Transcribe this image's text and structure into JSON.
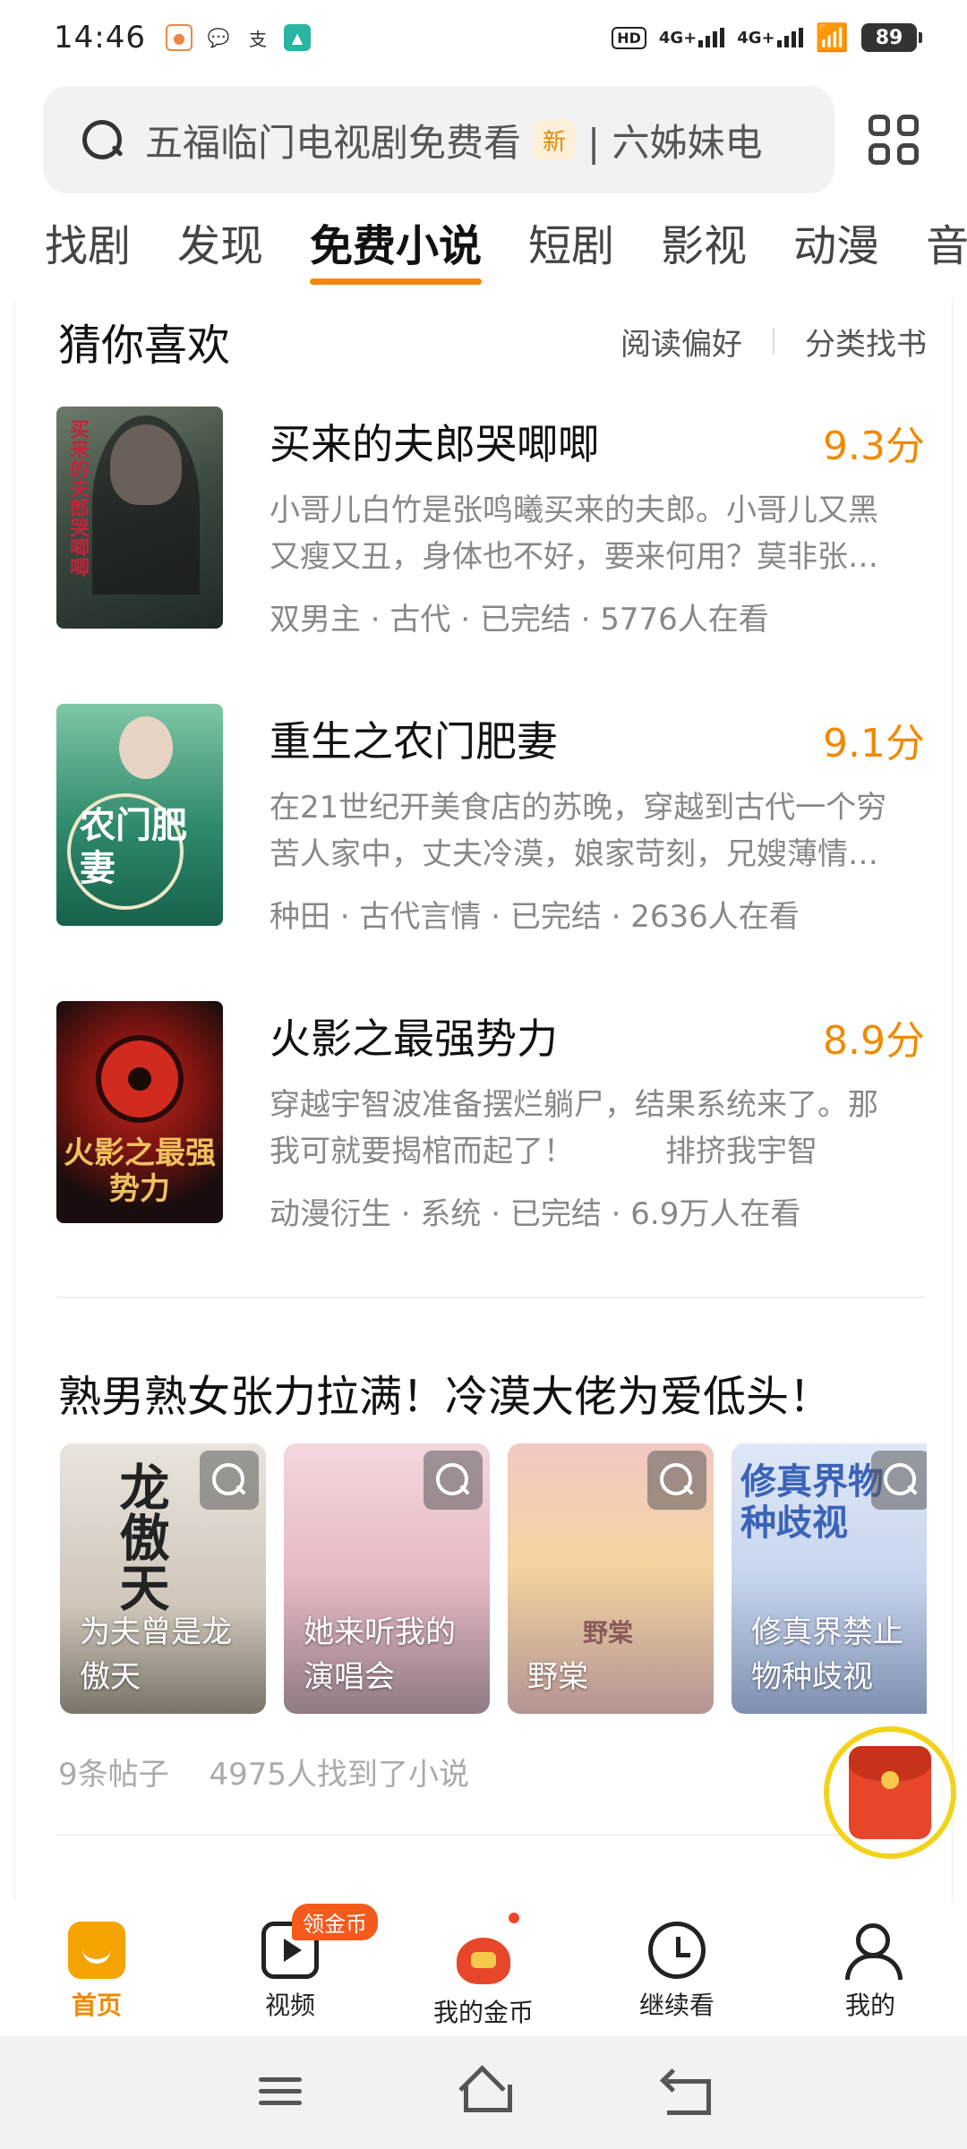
{
  "status_bar": {
    "time": "14:46",
    "app_icons": [
      "notification-app-icon",
      "message-icon",
      "alipay-icon",
      "app-store-icon"
    ],
    "hd_label": "HD",
    "net1": "4G+",
    "net2": "4G+",
    "battery": "89"
  },
  "search": {
    "placeholder_main": "五福临门电视剧免费看",
    "badge": "新",
    "placeholder_next": "| 六姊妹电"
  },
  "tabs": [
    {
      "label": "找剧",
      "active": false
    },
    {
      "label": "发现",
      "active": false
    },
    {
      "label": "免费小说",
      "active": true
    },
    {
      "label": "短剧",
      "active": false
    },
    {
      "label": "影视",
      "active": false
    },
    {
      "label": "动漫",
      "active": false
    },
    {
      "label": "音乐",
      "active": false
    }
  ],
  "recommend": {
    "title": "猜你喜欢",
    "link_prefs": "阅读偏好",
    "link_category": "分类找书",
    "books": [
      {
        "title": "买来的夫郎哭唧唧",
        "score": "9.3分",
        "desc": "小哥儿白竹是张鸣曦买来的夫郎。小哥儿又黑又瘦又丑，身体也不好，要来何用？莫非张…",
        "meta": "双男主 · 古代 · 已完结 · 5776人在看",
        "cover_text": "买来的夫郎哭唧唧"
      },
      {
        "title": "重生之农门肥妻",
        "score": "9.1分",
        "desc": "在21世纪开美食店的苏晚，穿越到古代一个穷苦人家中，丈夫冷漠，娘家苛刻，兄嫂薄情…",
        "meta": "种田 · 古代言情 · 已完结 · 2636人在看",
        "cover_text": "农门肥妻"
      },
      {
        "title": "火影之最强势力",
        "score": "8.9分",
        "desc": "穿越宇智波准备摆烂躺尸，结果系统来了。那我可就要揭棺而起了！　　　排挤我宇智波？…",
        "meta": "动漫衍生 · 系统 · 已完结 · 6.9万人在看",
        "cover_text": "火影之最强势力"
      }
    ]
  },
  "topic": {
    "title": "熟男熟女张力拉满！冷漠大佬为爱低头！",
    "cards": [
      {
        "title": "为夫曾是龙傲天",
        "cover_text": "龙傲天"
      },
      {
        "title": "她来听我的演唱会",
        "cover_text": ""
      },
      {
        "title": "野棠",
        "cover_text": "野棠"
      },
      {
        "title": "修真界禁止物种歧视",
        "cover_text": "修真界物种歧视"
      }
    ],
    "posts": "9条帖子",
    "found": "4975人找到了小说"
  },
  "bottom_nav": [
    {
      "label": "首页",
      "icon": "home-icon",
      "active": true
    },
    {
      "label": "视频",
      "icon": "video-icon",
      "active": false,
      "badge": "领金币"
    },
    {
      "label": "我的金币",
      "icon": "coin-bag-icon",
      "active": false
    },
    {
      "label": "继续看",
      "icon": "clock-icon",
      "active": false
    },
    {
      "label": "我的",
      "icon": "user-icon",
      "active": false
    }
  ],
  "colors": {
    "accent": "#f08a00",
    "score": "#f08a00",
    "muted_text": "#888888"
  }
}
